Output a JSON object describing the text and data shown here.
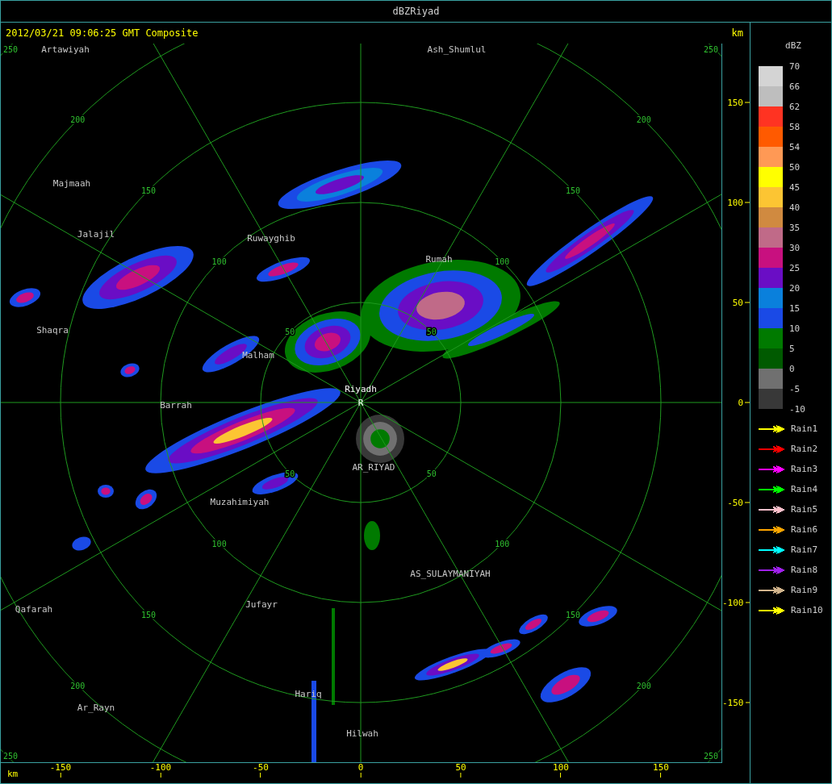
{
  "window": {
    "title": "dBZRiyad"
  },
  "header": {
    "timestamp": "2012/03/21 09:06:25 GMT Composite",
    "unit": "km"
  },
  "range_rings": [
    {
      "labels": [
        "50",
        "50",
        "50",
        "50"
      ]
    },
    {
      "labels": [
        "100",
        "100",
        "100",
        "100"
      ]
    },
    {
      "labels": [
        "150",
        "150",
        "150",
        "150"
      ]
    },
    {
      "labels": [
        "200",
        "200",
        "200",
        "200"
      ]
    },
    {
      "labels": [
        "250",
        "250",
        "250",
        "250"
      ]
    }
  ],
  "places": [
    {
      "name": "Artawiyah"
    },
    {
      "name": "Ash_Shumlul"
    },
    {
      "name": "Majmaah"
    },
    {
      "name": "Jalajil"
    },
    {
      "name": "Ruwayghib"
    },
    {
      "name": "Rumah"
    },
    {
      "name": "Shaqra"
    },
    {
      "name": "Malham"
    },
    {
      "name": "Barrah"
    },
    {
      "name": "AR_RIYAD"
    },
    {
      "name": "Muzahimiyah"
    },
    {
      "name": "AS_SULAYMANIYAH"
    },
    {
      "name": "Qafarah"
    },
    {
      "name": "Jufayr"
    },
    {
      "name": "Hariq"
    },
    {
      "name": "Ar_Rayn"
    },
    {
      "name": "Hilwah"
    }
  ],
  "radar": {
    "name": "Riyadh",
    "marker": "R"
  },
  "y_axis": {
    "ticks": [
      "150",
      "100",
      "50",
      "0",
      "-50",
      "-100",
      "-150"
    ]
  },
  "x_axis": {
    "unit": "km",
    "ticks": [
      "-150",
      "-100",
      "-50",
      "0",
      "50",
      "100",
      "150"
    ]
  },
  "legend": {
    "title": "dBZ",
    "scale_labels": [
      "70",
      "66",
      "62",
      "58",
      "54",
      "50",
      "45",
      "40",
      "35",
      "30",
      "25",
      "20",
      "15",
      "10",
      "5",
      "0",
      "-5",
      "-10"
    ],
    "swatches": [
      {
        "color": "#d4d4d4"
      },
      {
        "color": "#bebebe"
      },
      {
        "color": "#ff3322"
      },
      {
        "color": "#ff5a00"
      },
      {
        "color": "#ff9955"
      },
      {
        "color": "#ffff00"
      },
      {
        "color": "#fcc533"
      },
      {
        "color": "#d08a40"
      },
      {
        "color": "#c06a88"
      },
      {
        "color": "#c8107f"
      },
      {
        "color": "#6a0dc5"
      },
      {
        "color": "#0a80dc"
      },
      {
        "color": "#1a4ae6"
      },
      {
        "color": "#007a00"
      },
      {
        "color": "#005a00"
      },
      {
        "color": "#707070"
      },
      {
        "color": "#383838"
      }
    ],
    "tracks": [
      {
        "label": "Rain1",
        "color": "#ffff00"
      },
      {
        "label": "Rain2",
        "color": "#ff0000"
      },
      {
        "label": "Rain3",
        "color": "#ff00ff"
      },
      {
        "label": "Rain4",
        "color": "#00ff00"
      },
      {
        "label": "Rain5",
        "color": "#ffc0cb"
      },
      {
        "label": "Rain6",
        "color": "#ffa500"
      },
      {
        "label": "Rain7",
        "color": "#00ffff"
      },
      {
        "label": "Rain8",
        "color": "#a020f0"
      },
      {
        "label": "Rain9",
        "color": "#d2b48c"
      },
      {
        "label": "Rain10",
        "color": "#ffff00"
      }
    ]
  }
}
